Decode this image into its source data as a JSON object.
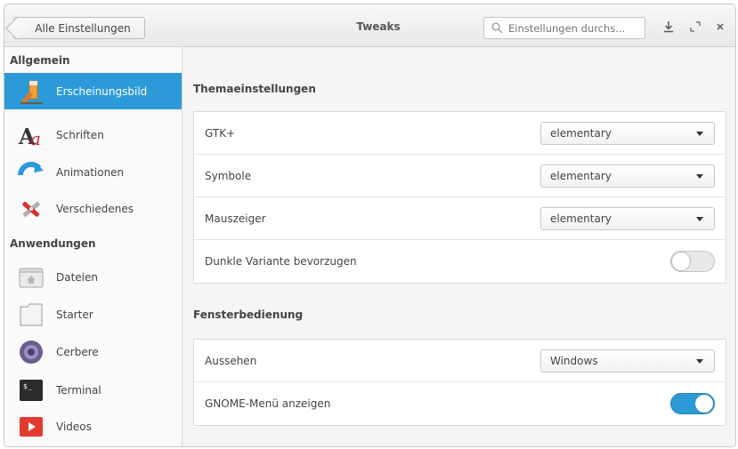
{
  "header": {
    "back_label": "Alle Einstellungen",
    "title": "Tweaks",
    "search_placeholder": "Einstellungen durchs...",
    "icons": [
      "download-icon",
      "maximize-icon",
      "close-icon"
    ]
  },
  "sidebar": {
    "groups": [
      {
        "heading": "Allgemein",
        "items": [
          {
            "label": "Erscheinungsbild",
            "icon": "appearance-icon",
            "selected": true
          },
          {
            "label": "Schriften",
            "icon": "fonts-icon",
            "selected": false
          },
          {
            "label": "Animationen",
            "icon": "animations-icon",
            "selected": false
          },
          {
            "label": "Verschiedenes",
            "icon": "misc-tools-icon",
            "selected": false
          }
        ]
      },
      {
        "heading": "Anwendungen",
        "items": [
          {
            "label": "Dateien",
            "icon": "files-icon",
            "selected": false
          },
          {
            "label": "Starter",
            "icon": "launcher-icon",
            "selected": false
          },
          {
            "label": "Cerbere",
            "icon": "cerbere-icon",
            "selected": false
          },
          {
            "label": "Terminal",
            "icon": "terminal-icon",
            "selected": false
          },
          {
            "label": "Videos",
            "icon": "videos-icon",
            "selected": false
          }
        ]
      }
    ]
  },
  "main": {
    "theme_section": {
      "title": "Themaeinstellungen",
      "rows": [
        {
          "label": "GTK+",
          "control": "dropdown",
          "value": "elementary"
        },
        {
          "label": "Symbole",
          "control": "dropdown",
          "value": "elementary"
        },
        {
          "label": "Mauszeiger",
          "control": "dropdown",
          "value": "elementary"
        },
        {
          "label": "Dunkle Variante bevorzugen",
          "control": "switch",
          "on": false
        }
      ]
    },
    "window_section": {
      "title": "Fensterbedienung",
      "rows": [
        {
          "label": "Aussehen",
          "control": "dropdown",
          "value": "Windows"
        },
        {
          "label": "GNOME-Menü anzeigen",
          "control": "switch",
          "on": true
        }
      ]
    }
  },
  "colors": {
    "accent": "#2b9ad5",
    "selection": "#2c9ad8"
  }
}
